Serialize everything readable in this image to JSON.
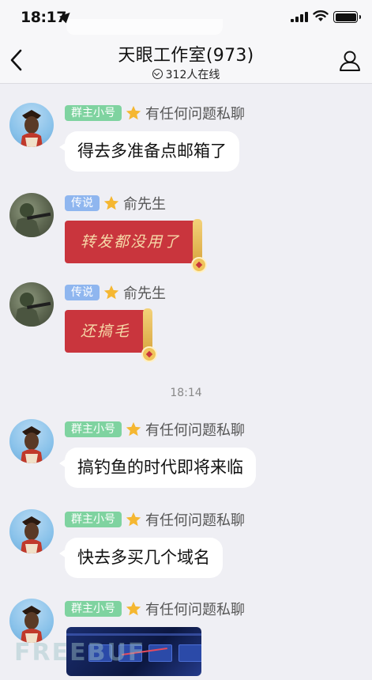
{
  "status": {
    "time": "18:17"
  },
  "header": {
    "title": "天眼工作室(973)",
    "online": "312人在线"
  },
  "messages": [
    {
      "badge": "群主小号",
      "name": "有任何问题私聊",
      "text": "得去多准备点邮箱了",
      "type": "text"
    },
    {
      "badge": "传说",
      "name": "俞先生",
      "text": "转发都没用了",
      "type": "redpacket"
    },
    {
      "badge": "传说",
      "name": "俞先生",
      "text": "还搞毛",
      "type": "redpacket"
    },
    {
      "badge": "群主小号",
      "name": "有任何问题私聊",
      "text": "搞钓鱼的时代即将来临",
      "type": "text"
    },
    {
      "badge": "群主小号",
      "name": "有任何问题私聊",
      "text": "快去多买几个域名",
      "type": "text"
    },
    {
      "badge": "群主小号",
      "name": "有任何问题私聊",
      "type": "image"
    }
  ],
  "timestamp": "18:14",
  "watermark": "FREEBUF",
  "colors": {
    "owner_badge": "#7fd3a0",
    "legend_badge": "#8fb6ef",
    "redpacket": "#c9353d"
  }
}
